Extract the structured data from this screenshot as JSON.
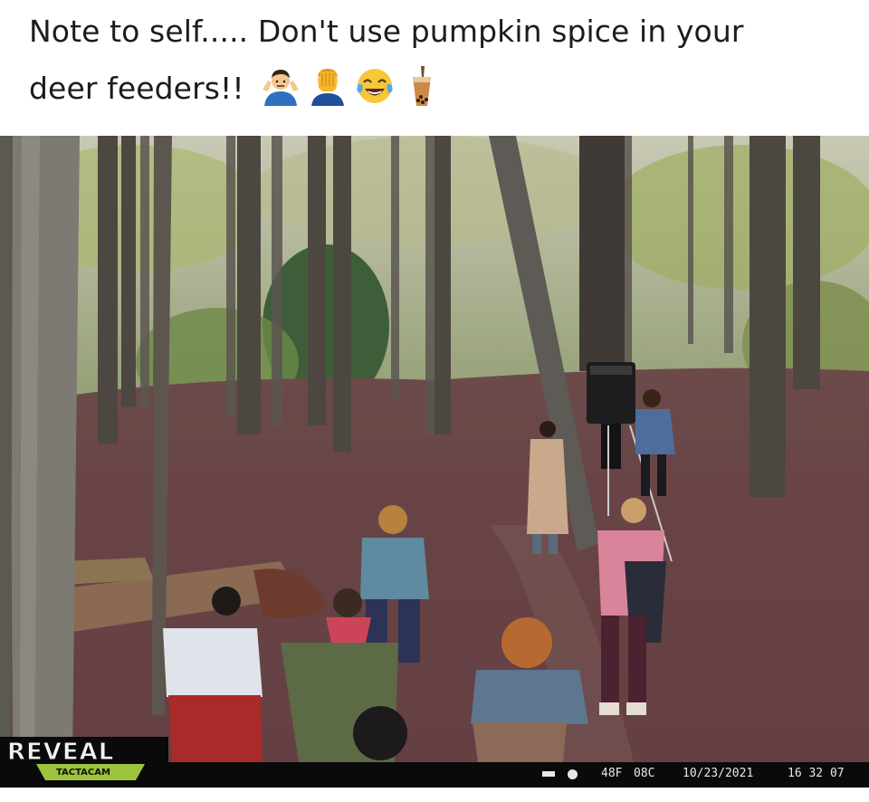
{
  "caption": {
    "line1": "Note to self..... Don't use pumpkin spice in your",
    "line2": "deer feeders!!",
    "emojis": [
      "man-shrugging-icon",
      "man-facepalming-icon",
      "face-with-tears-of-joy-icon",
      "bubble-tea-icon"
    ]
  },
  "camera": {
    "brand": "REVEAL",
    "model": "TACTACAM",
    "temp_f": "48F",
    "temp_c": "08C",
    "date": "10/23/2021",
    "time": "16 32 07"
  }
}
